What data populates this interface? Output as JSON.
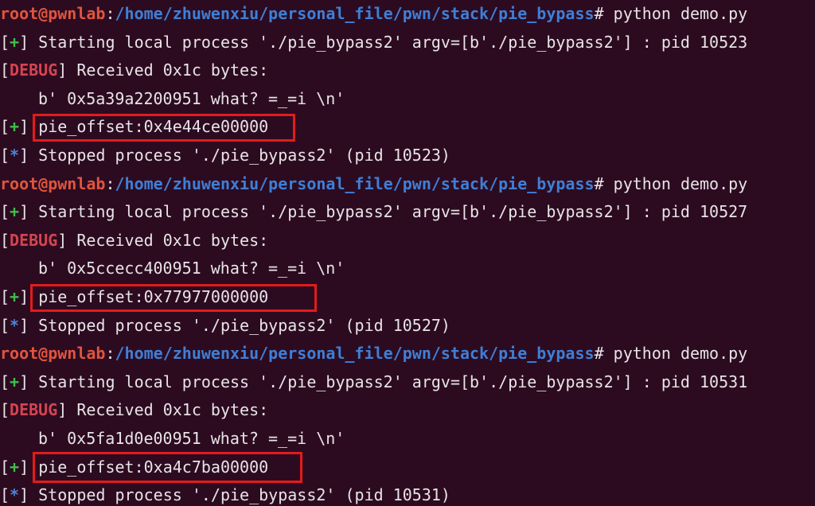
{
  "colors": {
    "background": "#2c0b21",
    "text": "#e8e4e6",
    "prompt_user": "#e0553d",
    "prompt_path": "#3f7fd6",
    "plus": "#3fbf4a",
    "star": "#4a86d8",
    "debug": "#d6444f",
    "highlight_box": "#e41b1b"
  },
  "runs": [
    {
      "prompt_user": "root@pwnlab",
      "prompt_colon": ":",
      "prompt_path": "/home/zhuwenxiu/personal_file/pwn/stack/pie_bypass",
      "prompt_hash": "#",
      "command": " python demo.py",
      "start_tag": "+",
      "start_text": " Starting local process './pie_bypass2' argv=[b'./pie_bypass2'] : pid 10523",
      "debug_tag": "DEBUG",
      "debug_text": " Received 0x1c bytes:",
      "received": "b' 0x5a39a2200951 what? =_=i \\n'",
      "offset_tag": "+",
      "offset_text": "pie_offset:0x4e44ce00000",
      "stop_tag": "*",
      "stop_text": " Stopped process './pie_bypass2' (pid 10523)"
    },
    {
      "prompt_user": "root@pwnlab",
      "prompt_colon": ":",
      "prompt_path": "/home/zhuwenxiu/personal_file/pwn/stack/pie_bypass",
      "prompt_hash": "#",
      "command": " python demo.py",
      "start_tag": "+",
      "start_text": " Starting local process './pie_bypass2' argv=[b'./pie_bypass2'] : pid 10527",
      "debug_tag": "DEBUG",
      "debug_text": " Received 0x1c bytes:",
      "received": "b' 0x5ccecc400951 what? =_=i \\n'",
      "offset_tag": "+",
      "offset_text": "pie_offset:0x77977000000",
      "stop_tag": "*",
      "stop_text": " Stopped process './pie_bypass2' (pid 10527)"
    },
    {
      "prompt_user": "root@pwnlab",
      "prompt_colon": ":",
      "prompt_path": "/home/zhuwenxiu/personal_file/pwn/stack/pie_bypass",
      "prompt_hash": "#",
      "command": " python demo.py",
      "start_tag": "+",
      "start_text": " Starting local process './pie_bypass2' argv=[b'./pie_bypass2'] : pid 10531",
      "debug_tag": "DEBUG",
      "debug_text": " Received 0x1c bytes:",
      "received": "b' 0x5fa1d0e00951 what? =_=i \\n'",
      "offset_tag": "+",
      "offset_text": "pie_offset:0xa4c7ba00000",
      "stop_tag": "*",
      "stop_text": " Stopped process './pie_bypass2' (pid 10531)"
    }
  ]
}
